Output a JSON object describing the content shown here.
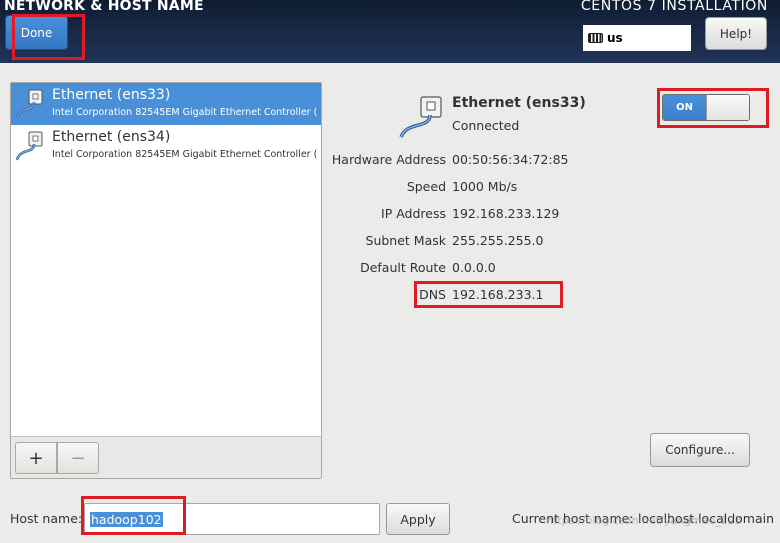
{
  "header": {
    "screen_title": "NETWORK & HOST NAME",
    "install_title": "CENTOS 7 INSTALLATION",
    "done_label": "Done",
    "keyboard_layout": "us",
    "help_label": "Help!"
  },
  "devices": [
    {
      "name": "Ethernet (ens33)",
      "description": "Intel Corporation 82545EM Gigabit Ethernet Controller (",
      "selected": true
    },
    {
      "name": "Ethernet (ens34)",
      "description": "Intel Corporation 82545EM Gigabit Ethernet Controller (",
      "selected": false
    }
  ],
  "device_toolbar": {
    "add_label": "+",
    "remove_label": "−"
  },
  "details": {
    "name": "Ethernet (ens33)",
    "status": "Connected",
    "toggle_label": "ON",
    "hardware_address_label": "Hardware Address",
    "hardware_address": "00:50:56:34:72:85",
    "speed_label": "Speed",
    "speed": "1000 Mb/s",
    "ip_label": "IP Address",
    "ip": "192.168.233.129",
    "subnet_label": "Subnet Mask",
    "subnet": "255.255.255.0",
    "route_label": "Default Route",
    "route": "0.0.0.0",
    "dns_label": "DNS",
    "dns": "192.168.233.1",
    "configure_label": "Configure..."
  },
  "hostname": {
    "label": "Host name:",
    "value": "hadoop102",
    "apply_label": "Apply",
    "current_label": "Current host name:",
    "current_value": "localhost.localdomain"
  },
  "watermark": "https://blog.csdn.net/yangmao_123",
  "colors": {
    "accent": "#4a90d9",
    "highlight": "#e01b24",
    "header": "#1a2b49"
  },
  "icons": {
    "ethernet": "ethernet-cable-icon",
    "keyboard": "keyboard-icon"
  }
}
